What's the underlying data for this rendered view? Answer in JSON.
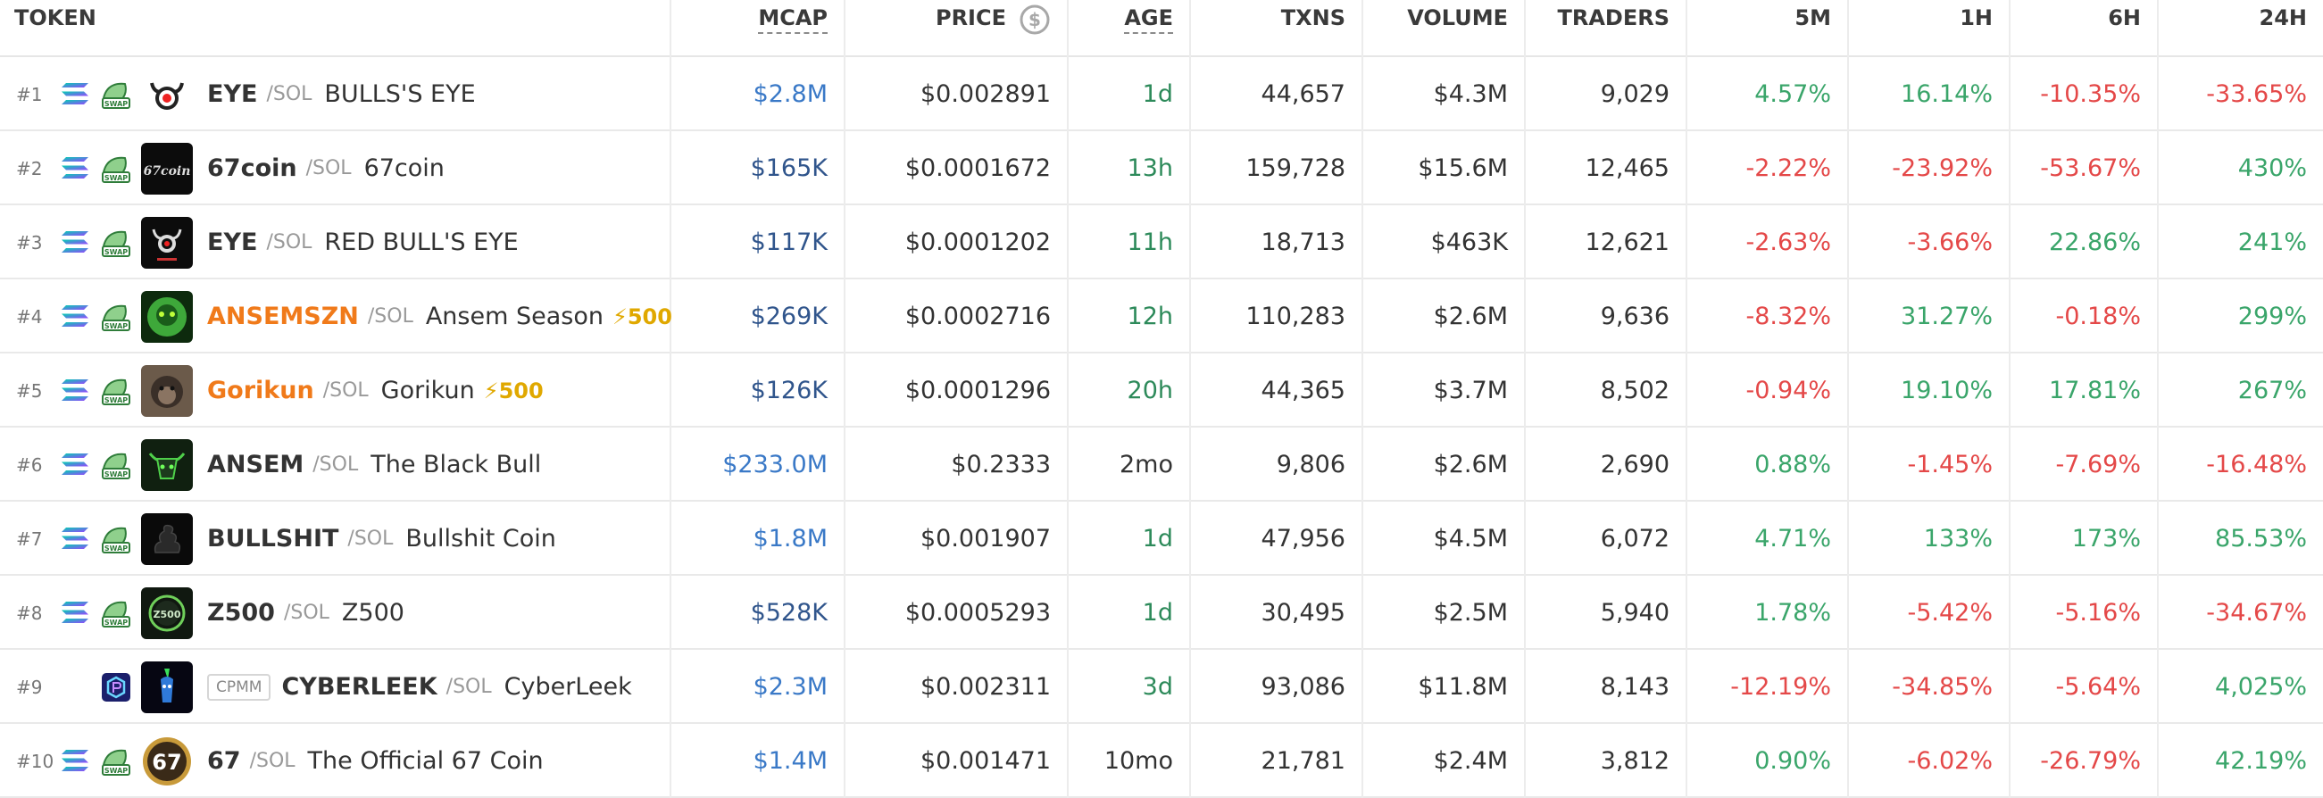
{
  "headers": {
    "token": "TOKEN",
    "mcap": "MCAP",
    "price": "PRICE",
    "age": "AGE",
    "txns": "TXNS",
    "volume": "VOLUME",
    "traders": "TRADERS",
    "m5": "5M",
    "h1": "1H",
    "h6": "6H",
    "h24": "24H"
  },
  "icons": {
    "chain": "solana-icon",
    "swap": "swap-icon",
    "currency": "dollar-circle-icon",
    "boost": "lightning-icon",
    "raydium": "raydium-icon"
  },
  "colors": {
    "positive": "#3aa56a",
    "negative": "#e44848",
    "mcap_light": "#3a79c7",
    "mcap_dark": "#30558c",
    "boosted_symbol": "#f07a1a",
    "boost": "#e0a800"
  },
  "rows": [
    {
      "rank": "#1",
      "symbol": "EYE",
      "quote": "/SOL",
      "name": "BULLS'S EYE",
      "boost": "",
      "tag": "",
      "mcap": "$2.8M",
      "price": "$0.002891",
      "age": "1d",
      "txns": "44,657",
      "volume": "$4.3M",
      "traders": "9,029",
      "m5": "4.57%",
      "h1": "16.14%",
      "h6": "-10.35%",
      "h24": "-33.65%"
    },
    {
      "rank": "#2",
      "symbol": "67coin",
      "quote": "/SOL",
      "name": "67coin",
      "boost": "",
      "tag": "",
      "mcap": "$165K",
      "price": "$0.0001672",
      "age": "13h",
      "txns": "159,728",
      "volume": "$15.6M",
      "traders": "12,465",
      "m5": "-2.22%",
      "h1": "-23.92%",
      "h6": "-53.67%",
      "h24": "430%"
    },
    {
      "rank": "#3",
      "symbol": "EYE",
      "quote": "/SOL",
      "name": "RED BULL'S EYE",
      "boost": "",
      "tag": "",
      "mcap": "$117K",
      "price": "$0.0001202",
      "age": "11h",
      "txns": "18,713",
      "volume": "$463K",
      "traders": "12,621",
      "m5": "-2.63%",
      "h1": "-3.66%",
      "h6": "22.86%",
      "h24": "241%"
    },
    {
      "rank": "#4",
      "symbol": "ANSEMSZN",
      "quote": "/SOL",
      "name": "Ansem Season",
      "boost": "500",
      "tag": "",
      "mcap": "$269K",
      "price": "$0.0002716",
      "age": "12h",
      "txns": "110,283",
      "volume": "$2.6M",
      "traders": "9,636",
      "m5": "-8.32%",
      "h1": "31.27%",
      "h6": "-0.18%",
      "h24": "299%"
    },
    {
      "rank": "#5",
      "symbol": "Gorikun",
      "quote": "/SOL",
      "name": "Gorikun",
      "boost": "500",
      "tag": "",
      "mcap": "$126K",
      "price": "$0.0001296",
      "age": "20h",
      "txns": "44,365",
      "volume": "$3.7M",
      "traders": "8,502",
      "m5": "-0.94%",
      "h1": "19.10%",
      "h6": "17.81%",
      "h24": "267%"
    },
    {
      "rank": "#6",
      "symbol": "ANSEM",
      "quote": "/SOL",
      "name": "The Black Bull",
      "boost": "",
      "tag": "",
      "mcap": "$233.0M",
      "price": "$0.2333",
      "age": "2mo",
      "txns": "9,806",
      "volume": "$2.6M",
      "traders": "2,690",
      "m5": "0.88%",
      "h1": "-1.45%",
      "h6": "-7.69%",
      "h24": "-16.48%"
    },
    {
      "rank": "#7",
      "symbol": "BULLSHIT",
      "quote": "/SOL",
      "name": "Bullshit Coin",
      "boost": "",
      "tag": "",
      "mcap": "$1.8M",
      "price": "$0.001907",
      "age": "1d",
      "txns": "47,956",
      "volume": "$4.5M",
      "traders": "6,072",
      "m5": "4.71%",
      "h1": "133%",
      "h6": "173%",
      "h24": "85.53%"
    },
    {
      "rank": "#8",
      "symbol": "Z500",
      "quote": "/SOL",
      "name": "Z500",
      "boost": "",
      "tag": "",
      "mcap": "$528K",
      "price": "$0.0005293",
      "age": "1d",
      "txns": "30,495",
      "volume": "$2.5M",
      "traders": "5,940",
      "m5": "1.78%",
      "h1": "-5.42%",
      "h6": "-5.16%",
      "h24": "-34.67%"
    },
    {
      "rank": "#9",
      "symbol": "CYBERLEEK",
      "quote": "/SOL",
      "name": "CyberLeek",
      "boost": "",
      "tag": "CPMM",
      "mcap": "$2.3M",
      "price": "$0.002311",
      "age": "3d",
      "txns": "93,086",
      "volume": "$11.8M",
      "traders": "8,143",
      "m5": "-12.19%",
      "h1": "-34.85%",
      "h6": "-5.64%",
      "h24": "4,025%"
    },
    {
      "rank": "#10",
      "symbol": "67",
      "quote": "/SOL",
      "name": "The Official 67 Coin",
      "boost": "",
      "tag": "",
      "mcap": "$1.4M",
      "price": "$0.001471",
      "age": "10mo",
      "txns": "21,781",
      "volume": "$2.4M",
      "traders": "3,812",
      "m5": "0.90%",
      "h1": "-6.02%",
      "h6": "-26.79%",
      "h24": "42.19%"
    }
  ]
}
